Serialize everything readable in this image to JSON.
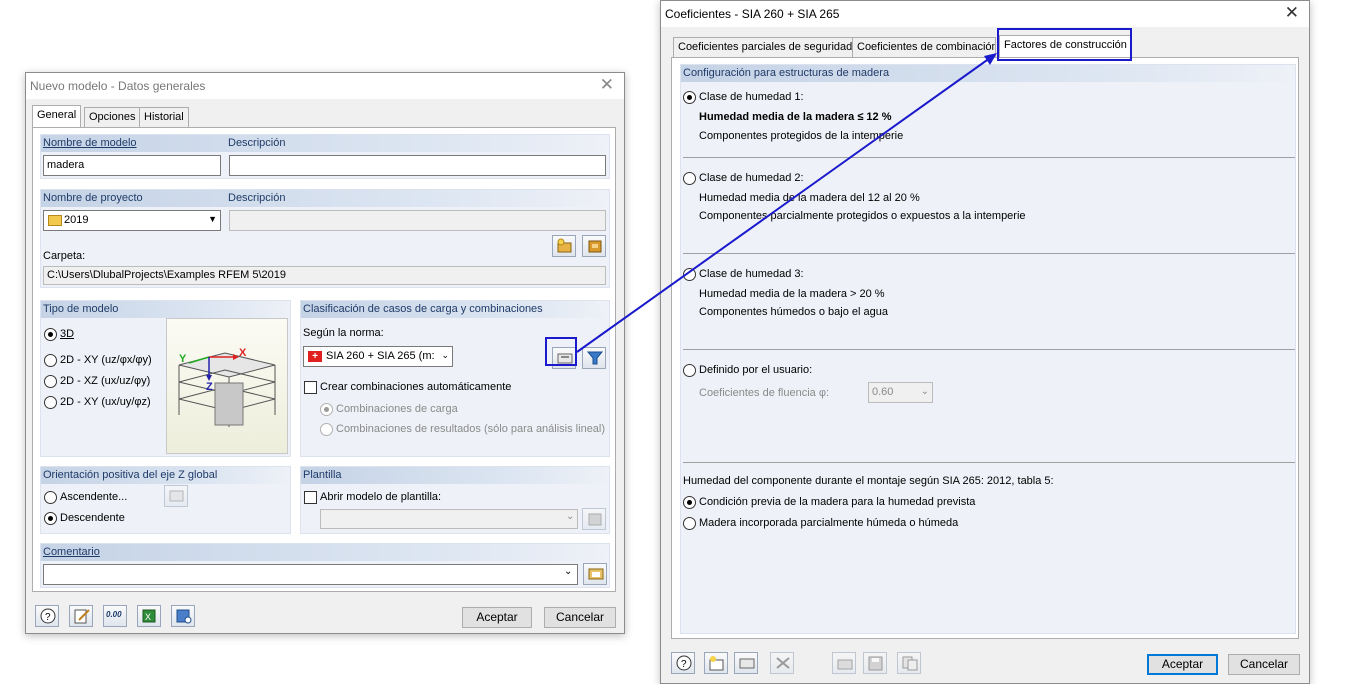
{
  "left_dialog": {
    "title": "Nuevo modelo - Datos generales",
    "tabs": [
      "General",
      "Opciones",
      "Historial"
    ],
    "model": {
      "name_label": "Nombre de modelo",
      "name_value": "madera",
      "desc_label": "Descripción",
      "desc_value": ""
    },
    "project": {
      "name_label": "Nombre de proyecto",
      "name_value": "2019",
      "desc_label": "Descripción",
      "desc_value": "",
      "folder_label": "Carpeta:",
      "folder_value": "C:\\Users\\DlubalProjects\\Examples RFEM 5\\2019"
    },
    "model_type": {
      "header": "Tipo de modelo",
      "options": [
        "3D",
        "2D - XY (uz/φx/φy)",
        "2D - XZ (ux/uz/φy)",
        "2D - XY (ux/uy/φz)"
      ],
      "selected": "3D",
      "axis_labels": {
        "x": "X",
        "y": "Y",
        "z": "Z"
      }
    },
    "classification": {
      "header": "Clasificación de casos de carga y combinaciones",
      "norm_label": "Según la norma:",
      "norm_value": "SIA 260 + SIA 265 (m:",
      "auto_combo_label": "Crear combinaciones automáticamente",
      "combo_load": "Combinaciones de carga",
      "combo_results": "Combinaciones de resultados (sólo para análisis lineal)"
    },
    "z_orientation": {
      "header": "Orientación positiva del eje Z global",
      "options": [
        "Ascendente...",
        "Descendente"
      ],
      "selected": "Descendente"
    },
    "template": {
      "header": "Plantilla",
      "open_label": "Abrir modelo de plantilla:",
      "value": ""
    },
    "comment": {
      "header": "Comentario",
      "value": ""
    },
    "footer": {
      "calc_icon_text": "0.00",
      "ok": "Aceptar",
      "cancel": "Cancelar"
    }
  },
  "right_dialog": {
    "title": "Coeficientes - SIA 260 + SIA 265",
    "tabs": [
      "Coeficientes parciales de seguridad",
      "Coeficientes de combinación",
      "Factores de construcción"
    ],
    "section_header": "Configuración para estructuras de madera",
    "moisture_classes": [
      {
        "label": "Clase de humedad 1:",
        "line1": "Humedad media de la madera ≤ 12 %",
        "line2": "Componentes protegidos de la intemperie",
        "selected": true
      },
      {
        "label": "Clase de humedad 2:",
        "line1": "Humedad media de la madera del 12 al 20 %",
        "line2": "Componentes parcialmente protegidos o expuestos a la intemperie",
        "selected": false
      },
      {
        "label": "Clase de humedad 3:",
        "line1": "Humedad media de la madera > 20 %",
        "line2": "Componentes húmedos o bajo el agua",
        "selected": false
      }
    ],
    "user_defined": {
      "label": "Definido por el usuario:",
      "creep_label": "Coeficientes de fluencia φ:",
      "creep_value": "0.60"
    },
    "assembly": {
      "header": "Humedad del componente durante el montaje según SIA 265: 2012, tabla 5:",
      "options": [
        "Condición previa de la madera para la humedad prevista",
        "Madera incorporada parcialmente húmeda o húmeda"
      ],
      "selected": 0
    },
    "footer": {
      "ok": "Aceptar",
      "cancel": "Cancelar"
    }
  },
  "colors": {
    "group_bg": "#eef1f7",
    "group_header": "#c5d3e6",
    "highlight": "#1a1acc"
  }
}
